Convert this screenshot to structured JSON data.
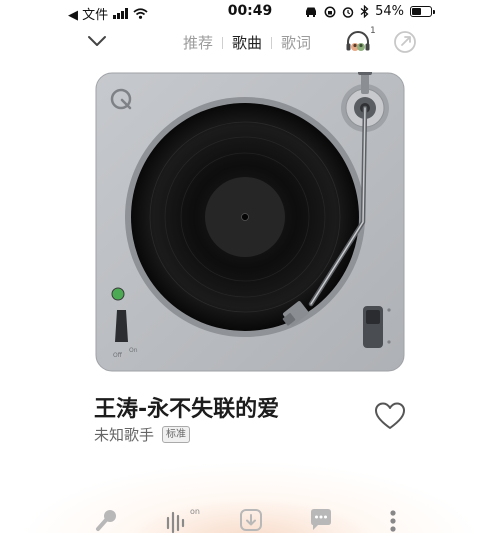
{
  "status_bar": {
    "back_app": "◀ 文件",
    "time": "00:49",
    "battery_percent": "54%",
    "battery_level": 0.54
  },
  "nav": {
    "tabs": [
      {
        "label": "推荐",
        "active": false
      },
      {
        "label": "歌曲",
        "active": true
      },
      {
        "label": "歌词",
        "active": false
      }
    ],
    "listen_together_count": "1"
  },
  "song": {
    "title": "王涛-永不失联的爱",
    "artist": "未知歌手",
    "quality_badge": "标准"
  },
  "turntable": {
    "switch_off_label": "Off",
    "switch_on_label": "On"
  },
  "toolbar": {
    "effect_on_label": "on"
  },
  "colors": {
    "turntable_body": "#b9bcc0",
    "record": "#141414",
    "accent_glow": "#f6d3bd"
  }
}
